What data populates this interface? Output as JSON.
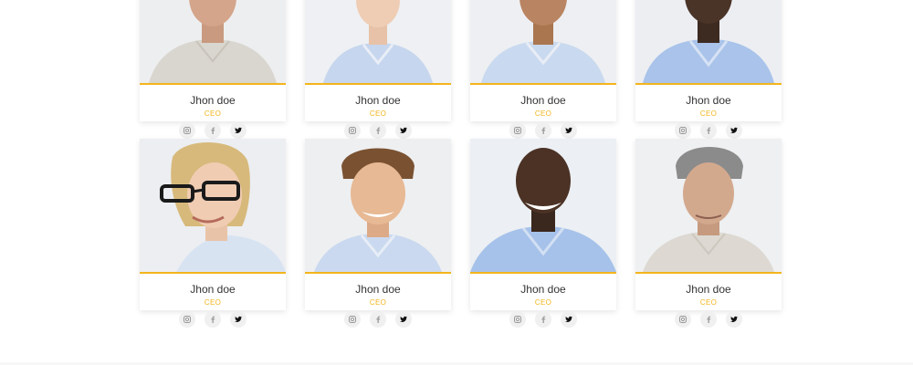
{
  "brand": {
    "accent": "#f3b51c"
  },
  "team_rows": [
    {
      "members": [
        {
          "name": "Jhon doe",
          "role": "CEO",
          "photo": "older-man-portrait"
        },
        {
          "name": "Jhon doe",
          "role": "CEO",
          "photo": "woman-portrait"
        },
        {
          "name": "Jhon doe",
          "role": "CEO",
          "photo": "man-portrait"
        },
        {
          "name": "Jhon doe",
          "role": "CEO",
          "photo": "man-blue-shirt-portrait"
        }
      ]
    },
    {
      "members": [
        {
          "name": "Jhon doe",
          "role": "CEO",
          "photo": "woman-glasses-portrait"
        },
        {
          "name": "Jhon doe",
          "role": "CEO",
          "photo": "man-smiling-portrait"
        },
        {
          "name": "Jhon doe",
          "role": "CEO",
          "photo": "man-blue-shirt-portrait"
        },
        {
          "name": "Jhon doe",
          "role": "CEO",
          "photo": "older-man-portrait"
        }
      ]
    }
  ],
  "social_icons": [
    "instagram-icon",
    "facebook-icon",
    "twitter-icon"
  ]
}
